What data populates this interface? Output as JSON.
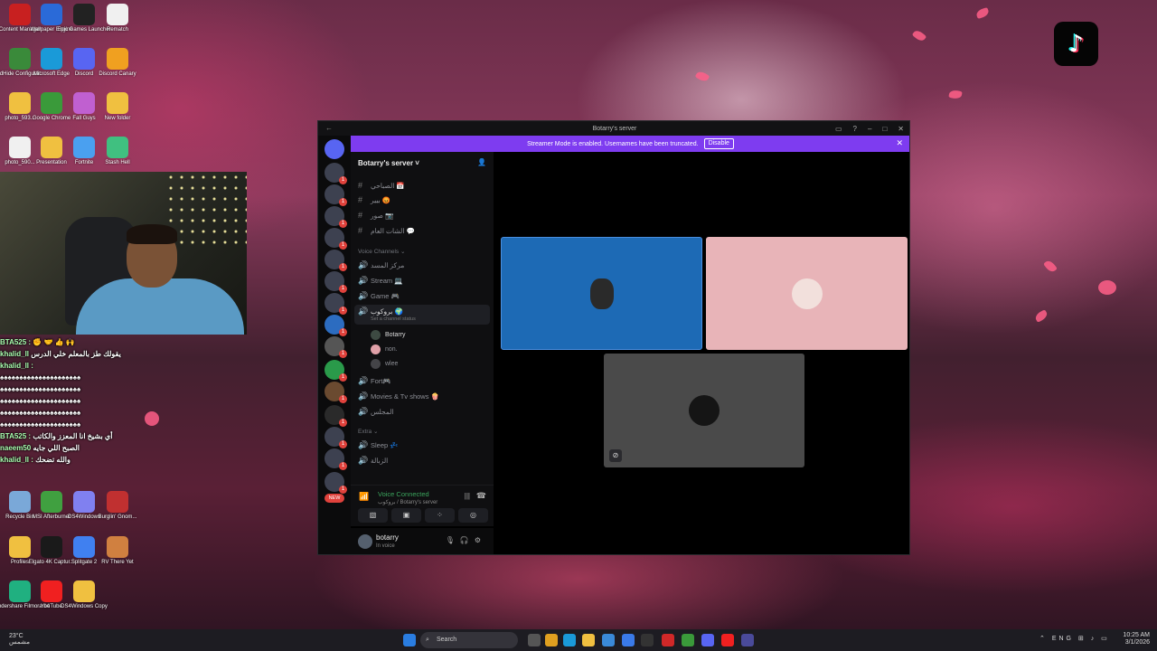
{
  "desktop_icons": [
    {
      "label": "Content Manager",
      "color": "#c82020"
    },
    {
      "label": "Wallpaper Engine",
      "color": "#2a6ad8"
    },
    {
      "label": "Epic Games Launcher",
      "color": "#222222"
    },
    {
      "label": "Rematch",
      "color": "#f0f0f0"
    },
    {
      "label": "HidHide Configurat...",
      "color": "#3a8a3a"
    },
    {
      "label": "Microsoft Edge",
      "color": "#1a9ad8"
    },
    {
      "label": "Discord",
      "color": "#5865f2"
    },
    {
      "label": "Discord Canary",
      "color": "#f0a020"
    },
    {
      "label": "photo_593...",
      "color": "#f0c040"
    },
    {
      "label": "Google Chrome",
      "color": "#3a9a3a"
    },
    {
      "label": "Fall Guys",
      "color": "#c060d0"
    },
    {
      "label": "New folder",
      "color": "#f0c040"
    },
    {
      "label": "photo_590...",
      "color": "#f0f0f0"
    },
    {
      "label": "Presentation",
      "color": "#f0c040"
    },
    {
      "label": "Fortnite",
      "color": "#4aa0f0"
    },
    {
      "label": "Stash Hell",
      "color": "#40c080"
    },
    {
      "label": "Recycle Bin",
      "color": "#7aa8d8"
    },
    {
      "label": "MSI Afterburner",
      "color": "#40a040"
    },
    {
      "label": "DS4Windows",
      "color": "#8080f0"
    },
    {
      "label": "Burglin' Gnom...",
      "color": "#c03030"
    },
    {
      "label": "Profiles",
      "color": "#f0c040"
    },
    {
      "label": "Elgato 4K Captur...",
      "color": "#1a1a1a"
    },
    {
      "label": "Splitgate 2",
      "color": "#4080f0"
    },
    {
      "label": "RV There Yet",
      "color": "#d08040"
    },
    {
      "label": "Wondershare Filmora 14",
      "color": "#20b080"
    },
    {
      "label": "YouTube",
      "color": "#f02020"
    },
    {
      "label": "DS4Windows Copy",
      "color": "#f0c040"
    }
  ],
  "chat": [
    {
      "user": "BTA525 :",
      "text": "✊ 🤝 👍 🙌"
    },
    {
      "user": "khalid_ll",
      "text": "يقولك طز بالمعلم خلي الدرس"
    },
    {
      "user": "khalid_ll :",
      "text": ""
    },
    {
      "user": "",
      "text": "♠♠♠♠♠♠♠♠♠♠♠♠♠♠♠♠♠♠♠♠♠"
    },
    {
      "user": "",
      "text": "♠♠♠♠♠♠♠♠♠♠♠♠♠♠♠♠♠♠♠♠♠"
    },
    {
      "user": "",
      "text": "♠♠♠♠♠♠♠♠♠♠♠♠♠♠♠♠♠♠♠♠♠"
    },
    {
      "user": "",
      "text": "♠♠♠♠♠♠♠♠♠♠♠♠♠♠♠♠♠♠♠♠♠"
    },
    {
      "user": "",
      "text": "♠♠♠♠♠♠♠♠♠♠♠♠♠♠♠♠♠♠♠♠♠"
    },
    {
      "user": "BTA525 :",
      "text": "أي بشيخ انا المعزز والكاتب"
    },
    {
      "user": "naeem50",
      "text": "الصبح اللي جايه"
    },
    {
      "user": "khalid_ll :",
      "text": "والله تضحك"
    }
  ],
  "taskbar": {
    "weather_temp": "23°C",
    "weather_desc": "مشمس",
    "search_placeholder": "Search",
    "lang": "ENG",
    "time": "10:25 AM",
    "date": "3/1/2026"
  },
  "discord": {
    "window_title": "Botarry's server",
    "banner_text": "Streamer Mode is enabled. Usernames have been truncated.",
    "banner_button": "Disable",
    "server_name": "Botarry's server",
    "channels_top": [
      {
        "name": "الصباحي 📅"
      },
      {
        "name": "بيير 😡"
      },
      {
        "name": "صور 📷"
      },
      {
        "name": "الشات العام 💬"
      }
    ],
    "voice_category": "Voice Channels",
    "voice_channels": [
      {
        "name": "مركز المسد"
      },
      {
        "name": "Stream 💻"
      },
      {
        "name": "Game 🎮"
      },
      {
        "name": "بروكوب 🌍",
        "status": "Set a channel status"
      }
    ],
    "voice_members": [
      {
        "name": "Botarry",
        "color": "#3d4a42"
      },
      {
        "name": "non.",
        "color": "#e0a0a8"
      },
      {
        "name": "wlee",
        "color": "#444448"
      }
    ],
    "voice_channels_2": [
      {
        "name": "Fort🎮"
      },
      {
        "name": "Movies & Tv shows 🍿"
      },
      {
        "name": "المجلس"
      }
    ],
    "extra_category": "Extra",
    "extra_channels": [
      {
        "name": "Sleep 💤"
      },
      {
        "name": "الزبالة"
      }
    ],
    "new_badge": "NEW",
    "voice_status": "Voice Connected",
    "voice_server": "بروكوب / Botarry's server",
    "user_name": "botarry",
    "user_status": "In voice",
    "tiles": [
      {
        "color": "#1d6ab5"
      },
      {
        "color": "#e8b4b8"
      },
      {
        "color": "#4a4a4a"
      }
    ]
  }
}
